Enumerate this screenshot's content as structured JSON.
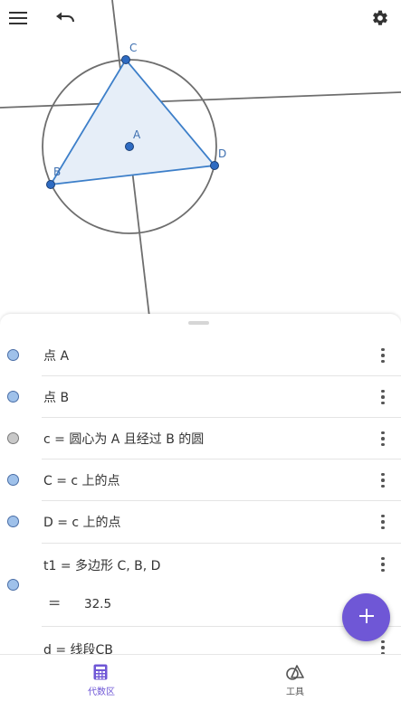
{
  "toolbar": {
    "menu_icon": "hamburger-menu-icon",
    "undo_icon": "undo-icon",
    "settings_icon": "gear-icon"
  },
  "graphics": {
    "point_labels": {
      "A": "A",
      "B": "B",
      "C": "C",
      "D": "D"
    },
    "colors": {
      "polygon_stroke": "#3d7fc9",
      "polygon_fill": "#e6eef8",
      "circle_stroke": "#6e6e6e",
      "point_fill": "#2e6bc2",
      "label": "#3d6fb0"
    }
  },
  "algebra": {
    "rows": [
      {
        "marble": "blue",
        "text": "点 A"
      },
      {
        "marble": "blue",
        "text": "点 B"
      },
      {
        "marble": "gray",
        "text": "c = 圆心为 A 且经过 B 的圆"
      },
      {
        "marble": "blue",
        "text": "C = c 上的点"
      },
      {
        "marble": "blue",
        "text": "D = c 上的点"
      },
      {
        "marble": "blue",
        "text": "t1 = 多边形 C, B, D",
        "value_prefix": "=",
        "value": "32.5"
      },
      {
        "marble": "none",
        "text": "d = 线段CB"
      }
    ]
  },
  "fab": {
    "label": "+",
    "color": "#6f57d6"
  },
  "bottom_nav": {
    "algebra_label": "代数区",
    "tools_label": "工具",
    "active_color": "#6f57d6"
  }
}
